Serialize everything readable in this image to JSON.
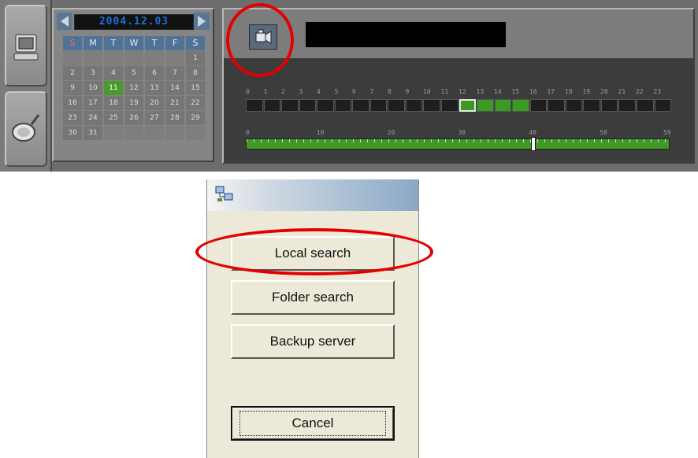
{
  "calendar": {
    "month_label": "2004.12.03",
    "weekdays": [
      "S",
      "M",
      "T",
      "W",
      "T",
      "F",
      "S"
    ],
    "days": [
      [
        "",
        "",
        "",
        "",
        "",
        "",
        "1"
      ],
      [
        "2",
        "3",
        "4",
        "5",
        "6",
        "7",
        "8"
      ],
      [
        "9",
        "10",
        "11",
        "12",
        "13",
        "14",
        "15"
      ],
      [
        "16",
        "17",
        "18",
        "19",
        "20",
        "21",
        "22"
      ],
      [
        "23",
        "24",
        "25",
        "26",
        "27",
        "28",
        "29"
      ],
      [
        "30",
        "31",
        "",
        "",
        "",
        "",
        ""
      ]
    ],
    "selected_day": "11"
  },
  "timeline": {
    "hour_labels": [
      "0",
      "1",
      "2",
      "3",
      "4",
      "5",
      "6",
      "7",
      "8",
      "9",
      "10",
      "11",
      "12",
      "13",
      "14",
      "15",
      "16",
      "17",
      "18",
      "19",
      "20",
      "21",
      "22",
      "23"
    ],
    "recorded_hours": [
      12,
      13,
      14,
      15
    ],
    "current_hour": 12,
    "minute_labels": [
      "0",
      "10",
      "20",
      "30",
      "40",
      "50",
      "59"
    ],
    "minute_cursor_value": 40,
    "minute_max": 59
  },
  "dialog": {
    "local_search": "Local search",
    "folder_search": "Folder search",
    "backup_server": "Backup server",
    "cancel": "Cancel"
  },
  "colors": {
    "highlight": "#e30000",
    "recorded": "#3b9a22",
    "dialog_bg": "#ece9d8"
  }
}
